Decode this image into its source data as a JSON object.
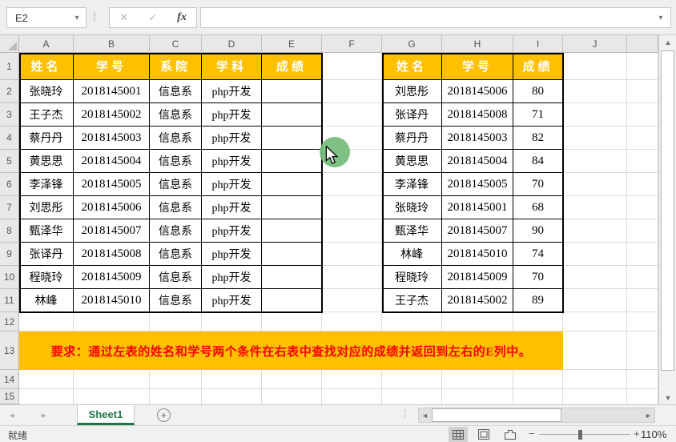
{
  "window": {
    "name_box": "E2",
    "formula_value": ""
  },
  "formula_bar": {
    "cancel": "✕",
    "enter": "✓",
    "fx": "fx",
    "namebox_chevron": "▾",
    "expand_chevron": "▾"
  },
  "grid": {
    "columns": [
      "A",
      "B",
      "C",
      "D",
      "E",
      "F",
      "G",
      "H",
      "I",
      "J"
    ],
    "rows": [
      "1",
      "2",
      "3",
      "4",
      "5",
      "6",
      "7",
      "8",
      "9",
      "10",
      "11",
      "12",
      "13",
      "14",
      "15"
    ]
  },
  "left_table": {
    "headers": [
      "姓名",
      "学号",
      "系院",
      "学科",
      "成绩"
    ],
    "rows": [
      [
        "张晓玲",
        "2018145001",
        "信息系",
        "php开发",
        ""
      ],
      [
        "王子杰",
        "2018145002",
        "信息系",
        "php开发",
        ""
      ],
      [
        "蔡丹丹",
        "2018145003",
        "信息系",
        "php开发",
        ""
      ],
      [
        "黄思思",
        "2018145004",
        "信息系",
        "php开发",
        ""
      ],
      [
        "李泽锋",
        "2018145005",
        "信息系",
        "php开发",
        ""
      ],
      [
        "刘思彤",
        "2018145006",
        "信息系",
        "php开发",
        ""
      ],
      [
        "甄泽华",
        "2018145007",
        "信息系",
        "php开发",
        ""
      ],
      [
        "张译丹",
        "2018145008",
        "信息系",
        "php开发",
        ""
      ],
      [
        "程晓玲",
        "2018145009",
        "信息系",
        "php开发",
        ""
      ],
      [
        "林峰",
        "2018145010",
        "信息系",
        "php开发",
        ""
      ]
    ]
  },
  "right_table": {
    "headers": [
      "姓名",
      "学号",
      "成绩"
    ],
    "rows": [
      [
        "刘思彤",
        "2018145006",
        "80"
      ],
      [
        "张译丹",
        "2018145008",
        "71"
      ],
      [
        "蔡丹丹",
        "2018145003",
        "82"
      ],
      [
        "黄思思",
        "2018145004",
        "84"
      ],
      [
        "李泽锋",
        "2018145005",
        "70"
      ],
      [
        "张晓玲",
        "2018145001",
        "68"
      ],
      [
        "甄泽华",
        "2018145007",
        "90"
      ],
      [
        "林峰",
        "2018145010",
        "74"
      ],
      [
        "程晓玲",
        "2018145009",
        "70"
      ],
      [
        "王子杰",
        "2018145002",
        "89"
      ]
    ]
  },
  "banner": {
    "text": "要求：通过左表的姓名和学号两个条件在右表中查找对应的成绩并返回到左右的E列中。"
  },
  "sheet_bar": {
    "active_tab": "Sheet1",
    "add_sheet": "+",
    "prev_arrow": "◂",
    "next_arrow": "▸"
  },
  "status_bar": {
    "ready": "就绪",
    "zoom_level": "110%",
    "zoom_minus": "−",
    "zoom_plus": "+"
  },
  "scrollbars": {
    "up": "▲",
    "down": "▼",
    "left": "◄",
    "right": "►"
  },
  "colors": {
    "header_fill": "#FFC000",
    "banner_fill": "#FFC000",
    "banner_text": "#FE0000",
    "accent_green": "#217346",
    "click_cursor_green": "#75BC7B"
  }
}
